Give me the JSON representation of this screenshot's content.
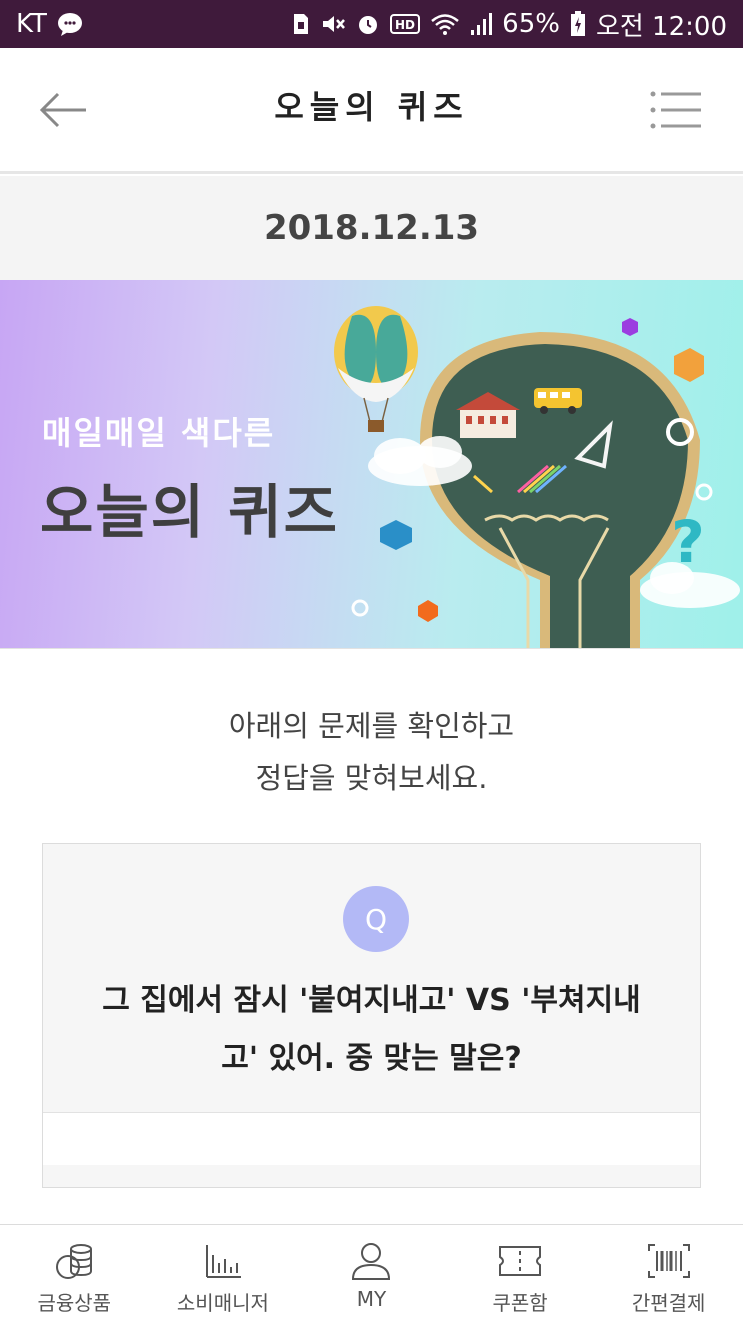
{
  "status_bar": {
    "carrier": "KT",
    "battery": "65%",
    "time": "오전 12:00"
  },
  "header": {
    "title": "오늘의 퀴즈"
  },
  "date": "2018.12.13",
  "banner": {
    "subtitle": "매일매일 색다른",
    "title": "오늘의 퀴즈"
  },
  "instruction": {
    "line1": "아래의 문제를 확인하고",
    "line2": "정답을 맞혀보세요."
  },
  "quiz": {
    "badge": "Q",
    "question_line1": "그 집에서 잠시 '붙여지내고' VS '부쳐지내",
    "question_line2": "고' 있어. 중 맞는 말은?"
  },
  "bottom_nav": [
    {
      "label": "금융상품",
      "icon": "coins-icon"
    },
    {
      "label": "소비매니저",
      "icon": "bar-chart-icon"
    },
    {
      "label": "MY",
      "icon": "person-icon"
    },
    {
      "label": "쿠폰함",
      "icon": "coupon-icon"
    },
    {
      "label": "간편결제",
      "icon": "barcode-icon"
    }
  ],
  "colors": {
    "status_bar": "#3f1a3b",
    "q_badge": "#b3b9f6"
  }
}
